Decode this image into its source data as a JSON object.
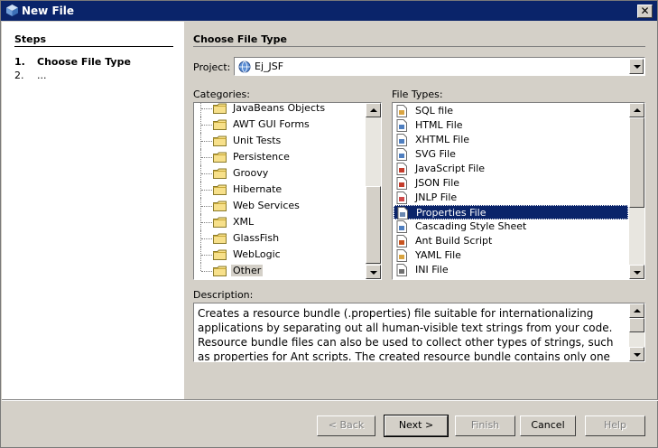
{
  "window": {
    "title": "New File",
    "close_glyph": "✕"
  },
  "steps": {
    "heading": "Steps",
    "items": [
      {
        "num": "1.",
        "label": "Choose File Type"
      },
      {
        "num": "2.",
        "label": "..."
      }
    ]
  },
  "main": {
    "heading": "Choose File Type",
    "project_label": "Project:",
    "project_value": "Ej_JSF",
    "categories_label": "Categories:",
    "file_types_label": "File Types:",
    "description_label": "Description:"
  },
  "categories": [
    "JavaBeans Objects",
    "AWT GUI Forms",
    "Unit Tests",
    "Persistence",
    "Groovy",
    "Hibernate",
    "Web Services",
    "XML",
    "GlassFish",
    "WebLogic",
    "Other"
  ],
  "categories_selected": "Other",
  "file_types": [
    {
      "label": "SQL file",
      "icon": "sql-file-icon"
    },
    {
      "label": "HTML File",
      "icon": "html-file-icon"
    },
    {
      "label": "XHTML File",
      "icon": "xhtml-file-icon"
    },
    {
      "label": "SVG File",
      "icon": "svg-file-icon"
    },
    {
      "label": "JavaScript File",
      "icon": "javascript-file-icon"
    },
    {
      "label": "JSON File",
      "icon": "json-file-icon"
    },
    {
      "label": "JNLP File",
      "icon": "jnlp-file-icon"
    },
    {
      "label": "Properties File",
      "icon": "properties-file-icon"
    },
    {
      "label": "Cascading Style Sheet",
      "icon": "css-file-icon"
    },
    {
      "label": "Ant Build Script",
      "icon": "ant-build-icon"
    },
    {
      "label": "YAML File",
      "icon": "yaml-file-icon"
    },
    {
      "label": "INI File",
      "icon": "ini-file-icon"
    }
  ],
  "file_types_selected": "Properties File",
  "description": "Creates a resource bundle (.properties) file suitable for internationalizing applications by separating out all human-visible text strings from your code. Resource bundle files can also be used to collect other types of strings, such as properties for Ant scripts. The created resource bundle contains only one locale.",
  "buttons": {
    "back": "< Back",
    "next": "Next >",
    "finish": "Finish",
    "cancel": "Cancel",
    "help": "Help"
  },
  "colors": {
    "title_bar": "#0a246a",
    "selection": "#0a246a",
    "dialog_bg": "#d4d0c8"
  }
}
